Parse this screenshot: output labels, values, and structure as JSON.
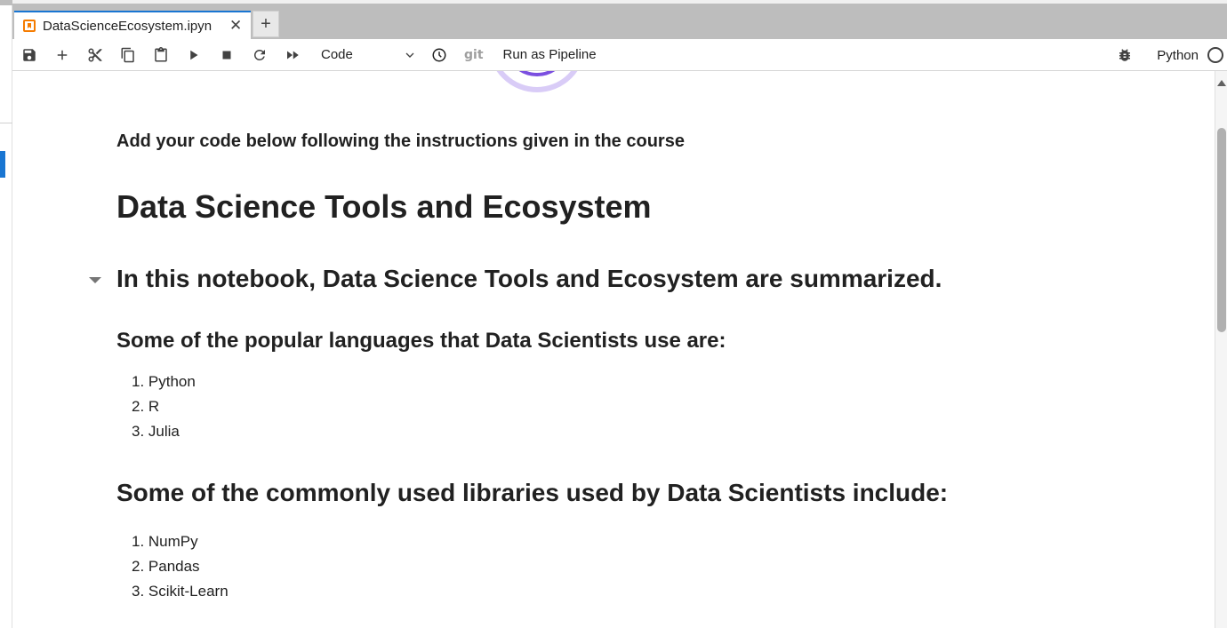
{
  "tab": {
    "label": "DataScienceEcosystem.ipyn",
    "close": "✕",
    "new": "+"
  },
  "toolbar": {
    "cell_type": "Code",
    "git": "git",
    "pipeline": "Run as Pipeline",
    "kernel": "Python"
  },
  "notebook": {
    "intro": "Add your code below following the instructions given in the course",
    "h1": "Data Science Tools and Ecosystem",
    "h2": "In this notebook, Data Science Tools and Ecosystem are summarized.",
    "languages_heading": "Some of the popular languages that Data Scientists use are:",
    "languages": [
      "1. Python",
      "2. R",
      "3. Julia"
    ],
    "libraries_heading": "Some of the commonly used libraries used by Data Scientists include:",
    "libraries": [
      "1. NumPy",
      "2. Pandas",
      "3. Scikit-Learn"
    ]
  }
}
